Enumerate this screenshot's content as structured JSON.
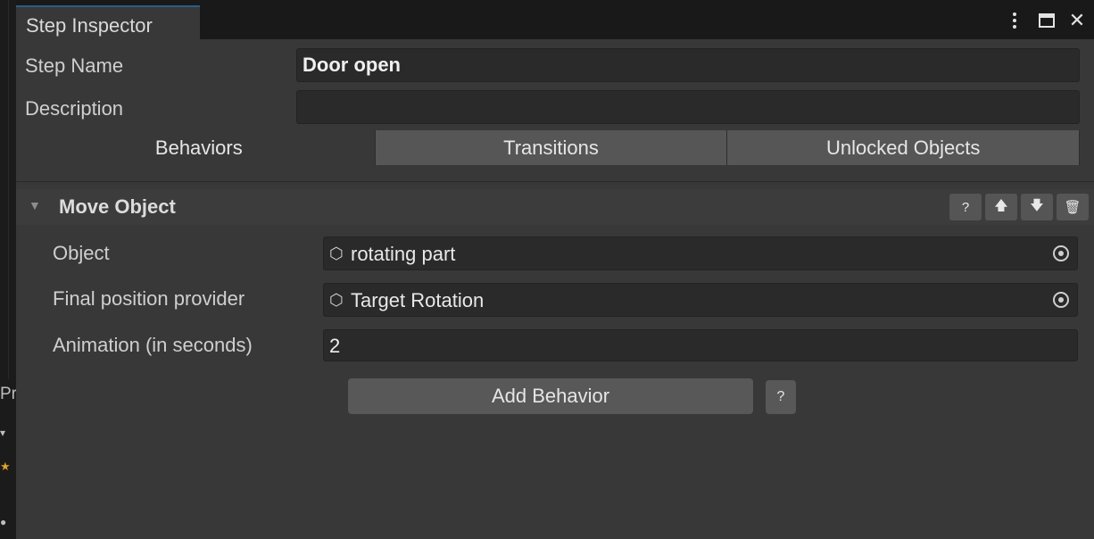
{
  "window": {
    "tab_title": "Step Inspector",
    "icons": [
      "kebab-menu-icon",
      "maximize-icon",
      "close-icon"
    ],
    "close_glyph": "✕"
  },
  "side_panel": {
    "fragment_text": "Pr"
  },
  "step": {
    "name_label": "Step Name",
    "name_value": "Door open",
    "description_label": "Description",
    "description_value": ""
  },
  "tabs": [
    {
      "label": "Behaviors",
      "active": true
    },
    {
      "label": "Transitions",
      "active": false
    },
    {
      "label": "Unlocked Objects",
      "active": false
    }
  ],
  "behavior": {
    "title": "Move Object",
    "help_glyph": "?",
    "up_glyph": "🡅",
    "down_glyph": "🡇",
    "delete_glyph": "🗑",
    "fields": {
      "object_label": "Object",
      "object_value": "rotating part",
      "final_position_label": "Final position provider",
      "final_position_value": "Target Rotation",
      "animation_label": "Animation (in seconds)",
      "animation_value": "2"
    }
  },
  "actions": {
    "add_behavior_label": "Add Behavior",
    "help_glyph": "?"
  },
  "colors": {
    "background": "#383838",
    "field": "#2a2a2a",
    "button": "#585858",
    "tab_accent": "#2c5d87"
  }
}
